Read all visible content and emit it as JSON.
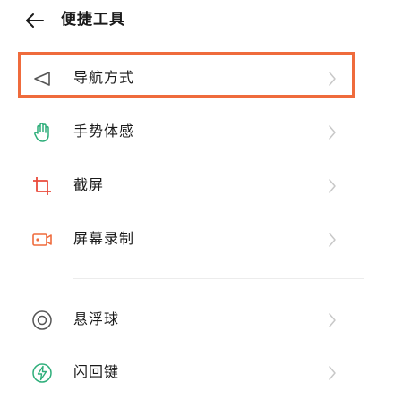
{
  "header": {
    "title": "便捷工具",
    "back_icon": "arrow-left-icon"
  },
  "items": [
    {
      "label": "导航方式",
      "icon": "navigation-triangle-icon",
      "icon_color": "#555555",
      "highlighted": true
    },
    {
      "label": "手势体感",
      "icon": "hand-gesture-icon",
      "icon_color": "#2eae7a"
    },
    {
      "label": "截屏",
      "icon": "crop-icon",
      "icon_color": "#ea4a3b"
    },
    {
      "label": "屏幕录制",
      "icon": "video-camera-icon",
      "icon_color": "#ef6b3c"
    },
    {
      "label": "悬浮球",
      "icon": "floating-ball-icon",
      "icon_color": "#555555"
    },
    {
      "label": "闪回键",
      "icon": "lightning-icon",
      "icon_color": "#2eae7a"
    }
  ],
  "colors": {
    "highlight_border": "#ef6b3c",
    "chevron": "#c8c8c8",
    "text": "#1a1a1a"
  }
}
